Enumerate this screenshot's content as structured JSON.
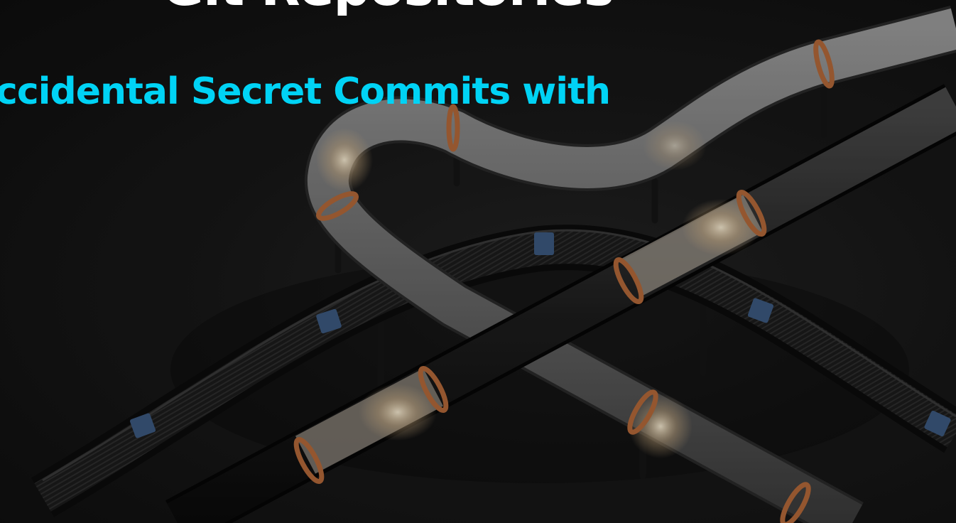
{
  "hero": {
    "title": "Git Repositories",
    "subtitle": "ccidental Secret Commits with"
  },
  "colors": {
    "background": "#141414",
    "title_text": "#ffffff",
    "subtitle_text": "#00d3f5",
    "pipe_ring": "#b56a3a",
    "conveyor_box": "#3c5a80"
  },
  "illustration": {
    "description_icon": "pipes-and-conveyor-illustration"
  }
}
